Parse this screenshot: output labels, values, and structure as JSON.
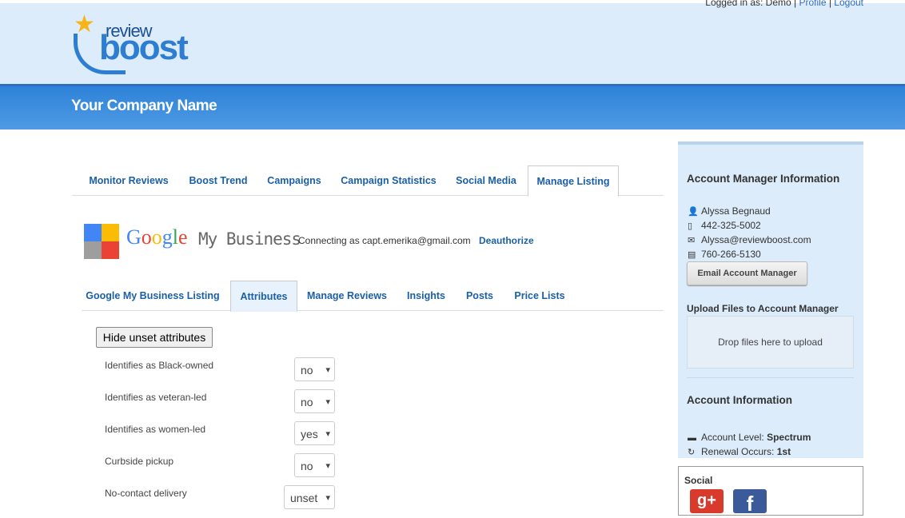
{
  "header": {
    "top_links": [
      "Logged in as: Demo",
      "Profile",
      "Logout"
    ],
    "logo": {
      "small": "review",
      "big": "boost"
    },
    "company_name": "Your Company Name"
  },
  "tabs": [
    "Monitor Reviews",
    "Boost Trend",
    "Campaigns",
    "Campaign Statistics",
    "Social Media",
    "Manage Listing"
  ],
  "active_tab": "Manage Listing",
  "gmb": {
    "google": "Google",
    "my_business": "My Business",
    "connecting": "Connecting as capt.emerika@gmail.com",
    "deauthorize": "Deauthorize"
  },
  "subtabs": [
    "Google My Business Listing",
    "Attributes",
    "Manage Reviews",
    "Insights",
    "Posts",
    "Price Lists"
  ],
  "active_subtab": "Attributes",
  "hide_button": "Hide unset attributes",
  "attributes": [
    {
      "label": "Identifies as Black-owned",
      "value": "no"
    },
    {
      "label": "Identifies as veteran-led",
      "value": "no"
    },
    {
      "label": "Identifies as women-led",
      "value": "yes"
    },
    {
      "label": "Curbside pickup",
      "value": "no"
    },
    {
      "label": "No-contact delivery",
      "value": "unset"
    }
  ],
  "account_manager": {
    "title": "Account Manager Information",
    "name": "Alyssa Begnaud",
    "phone": "442-325-5002",
    "email": "Alyssa@reviewboost.com",
    "fax": "760-266-5130",
    "email_button": "Email Account Manager"
  },
  "upload": {
    "title": "Upload Files to Account Manager",
    "drop_text": "Drop files here to upload"
  },
  "account_info": {
    "title": "Account Information",
    "level_label": "Account Level:",
    "level_value": "Spectrum",
    "renewal_label": "Renewal Occurs:",
    "renewal_value": "1st"
  },
  "social": {
    "title": "Social",
    "icons": [
      "google-plus-icon",
      "facebook-icon"
    ],
    "google_plus_glyph": "g+",
    "facebook_glyph": "f"
  },
  "colors": {
    "header_bg": "#dcecfb",
    "bar_blue": "#3a8ade",
    "link_blue": "#1a5fa8"
  }
}
